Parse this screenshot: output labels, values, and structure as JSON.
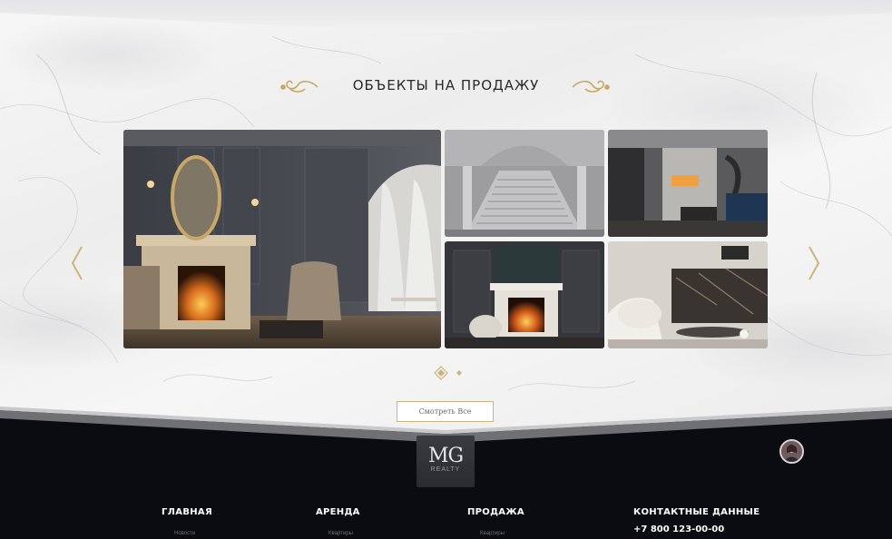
{
  "section": {
    "title": "ОБЪЕКТЫ НА ПРОДАЖУ",
    "view_all_label": "Смотреть Все"
  },
  "gallery": {
    "images": [
      {
        "name": "classic-living-room-fireplace"
      },
      {
        "name": "grand-staircase-hall"
      },
      {
        "name": "modern-interior-fireplace"
      },
      {
        "name": "fireplace-dark-wall"
      },
      {
        "name": "marble-fireplace-lounge"
      }
    ],
    "pagination": {
      "total": 2,
      "active": 1
    }
  },
  "footer": {
    "logo_text": "MG",
    "logo_subtext": "REALTY",
    "columns": [
      {
        "title": "ГЛАВНАЯ",
        "sub": "Новости"
      },
      {
        "title": "АРЕНДА",
        "sub": "Квартиры"
      },
      {
        "title": "ПРОДАЖА",
        "sub": "Квартиры"
      },
      {
        "title": "КОНТАКТНЫЕ ДАННЫЕ"
      }
    ],
    "phone": "+7 800 123-00-00"
  },
  "colors": {
    "gold": "#cdb57a",
    "footer_bg": "#0b0c11",
    "marble": "#f2f2f2"
  },
  "icons": [
    "flourish-icon",
    "chevron-left-icon",
    "chevron-right-icon",
    "pagination-dot-icon",
    "avatar-icon"
  ]
}
